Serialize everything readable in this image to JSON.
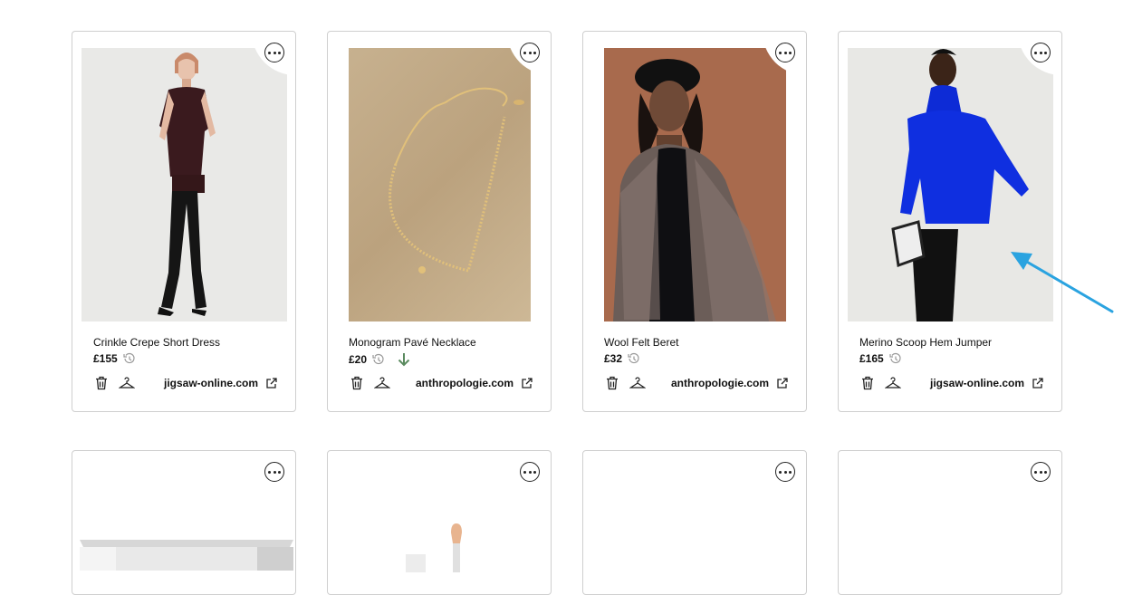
{
  "products": [
    {
      "title": "Crinkle Crepe Short Dress",
      "price": "£155",
      "store": "jigsaw-online.com",
      "price_trend": "none"
    },
    {
      "title": "Monogram Pavé Necklace",
      "price": "£20",
      "store": "anthropologie.com",
      "price_trend": "down"
    },
    {
      "title": "Wool Felt Beret",
      "price": "£32",
      "store": "anthropologie.com",
      "price_trend": "none"
    },
    {
      "title": "Merino Scoop Hem Jumper",
      "price": "£165",
      "store": "jigsaw-online.com",
      "price_trend": "none"
    }
  ],
  "icons": {
    "more": "more-options-icon",
    "history": "price-history-icon",
    "trend": "price-down-arrow-icon",
    "delete": "trash-icon",
    "wardrobe": "hanger-icon",
    "external": "external-link-icon"
  },
  "colors": {
    "price_down": "#5a8a5f",
    "annotation_arrow": "#2aa3e0"
  }
}
